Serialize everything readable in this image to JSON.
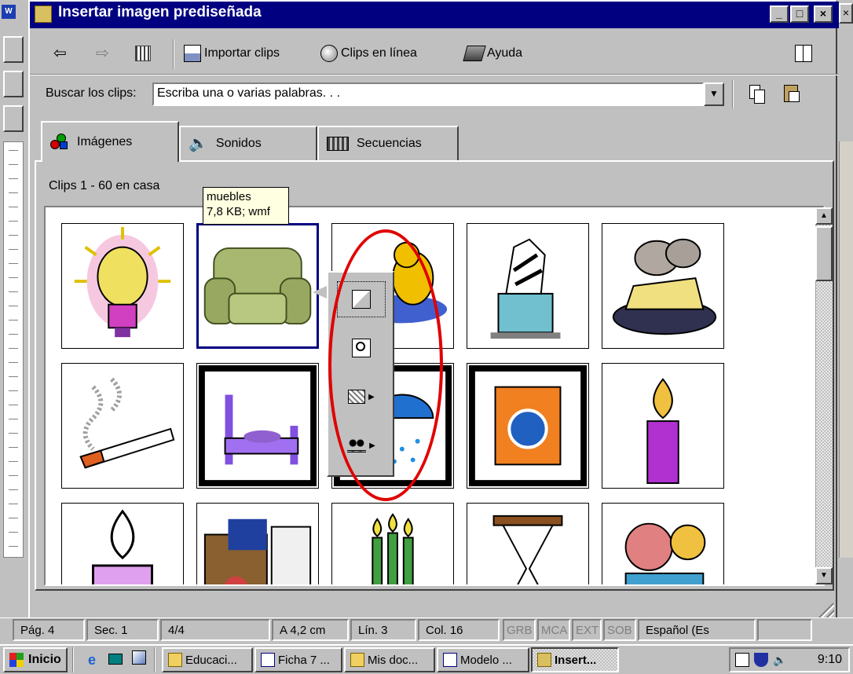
{
  "background_window": {
    "app_icon": "word-icon"
  },
  "dialog": {
    "title": "Insertar imagen prediseñada",
    "title_icon": "clipart-gallery-icon",
    "window_buttons": {
      "minimize": "_",
      "maximize": "□",
      "close": "×"
    }
  },
  "toolbar": {
    "back_icon": "back-arrow-icon",
    "forward_icon": "forward-arrow-icon",
    "view_icon": "small-window-icon",
    "import_clips": "Importar clips",
    "clips_online": "Clips en línea",
    "help": "Ayuda",
    "pin_icon": "change-to-small-window-icon"
  },
  "search": {
    "label": "Buscar los clips:",
    "value": "Escriba una o varias palabras. . .",
    "copy_icon": "copy-icon",
    "paste_icon": "paste-icon"
  },
  "tabs": [
    {
      "label": "Imágenes",
      "icon": "pictures-icon",
      "active": true
    },
    {
      "label": "Sonidos",
      "icon": "sounds-icon",
      "active": false
    },
    {
      "label": "Secuencias",
      "icon": "motion-clips-icon",
      "active": false
    }
  ],
  "clips": {
    "count_text": "Clips 1 - 60 en casa",
    "tooltip": {
      "name": "muebles",
      "info": "7,8 KB; wmf"
    },
    "items": [
      {
        "icon": "light-bulb-clip"
      },
      {
        "icon": "armchair-clip",
        "selected": true
      },
      {
        "icon": "duck-pond-clip"
      },
      {
        "icon": "trash-can-clip"
      },
      {
        "icon": "mice-cheese-clip"
      },
      {
        "icon": "cigarette-clip"
      },
      {
        "icon": "bed-clip"
      },
      {
        "icon": "shower-clip"
      },
      {
        "icon": "washing-machine-clip"
      },
      {
        "icon": "candle-clip"
      },
      {
        "icon": "purple-candle-clip"
      },
      {
        "icon": "cluttered-room-clip"
      },
      {
        "icon": "green-candles-clip"
      },
      {
        "icon": "hourglass-clip"
      },
      {
        "icon": "alarm-clock-clip"
      }
    ]
  },
  "context_menu": {
    "items": [
      {
        "icon": "insert-clip-icon",
        "submenu": false
      },
      {
        "icon": "preview-clip-icon",
        "submenu": false
      },
      {
        "icon": "add-to-category-icon",
        "submenu": true
      },
      {
        "icon": "find-similar-icon",
        "submenu": true
      }
    ]
  },
  "status_bar": {
    "page": "Pág. 4",
    "section": "Sec. 1",
    "pages": "4/4",
    "position": "A 4,2 cm",
    "line": "Lín. 3",
    "column": "Col. 16",
    "rec": "GRB",
    "mca": "MCA",
    "ext": "EXT",
    "sob": "SOB",
    "language": "Español (Es"
  },
  "taskbar": {
    "start": "Inicio",
    "tasks": [
      "Educaci...",
      "Ficha 7 ...",
      "Mis doc...",
      "Modelo ...",
      "Insert..."
    ],
    "clock": "9:10"
  },
  "colors": {
    "titlebar": "#000080",
    "highlight_ellipse": "#e00000",
    "tooltip_bg": "#ffffe1",
    "selection_border": "#000080"
  }
}
